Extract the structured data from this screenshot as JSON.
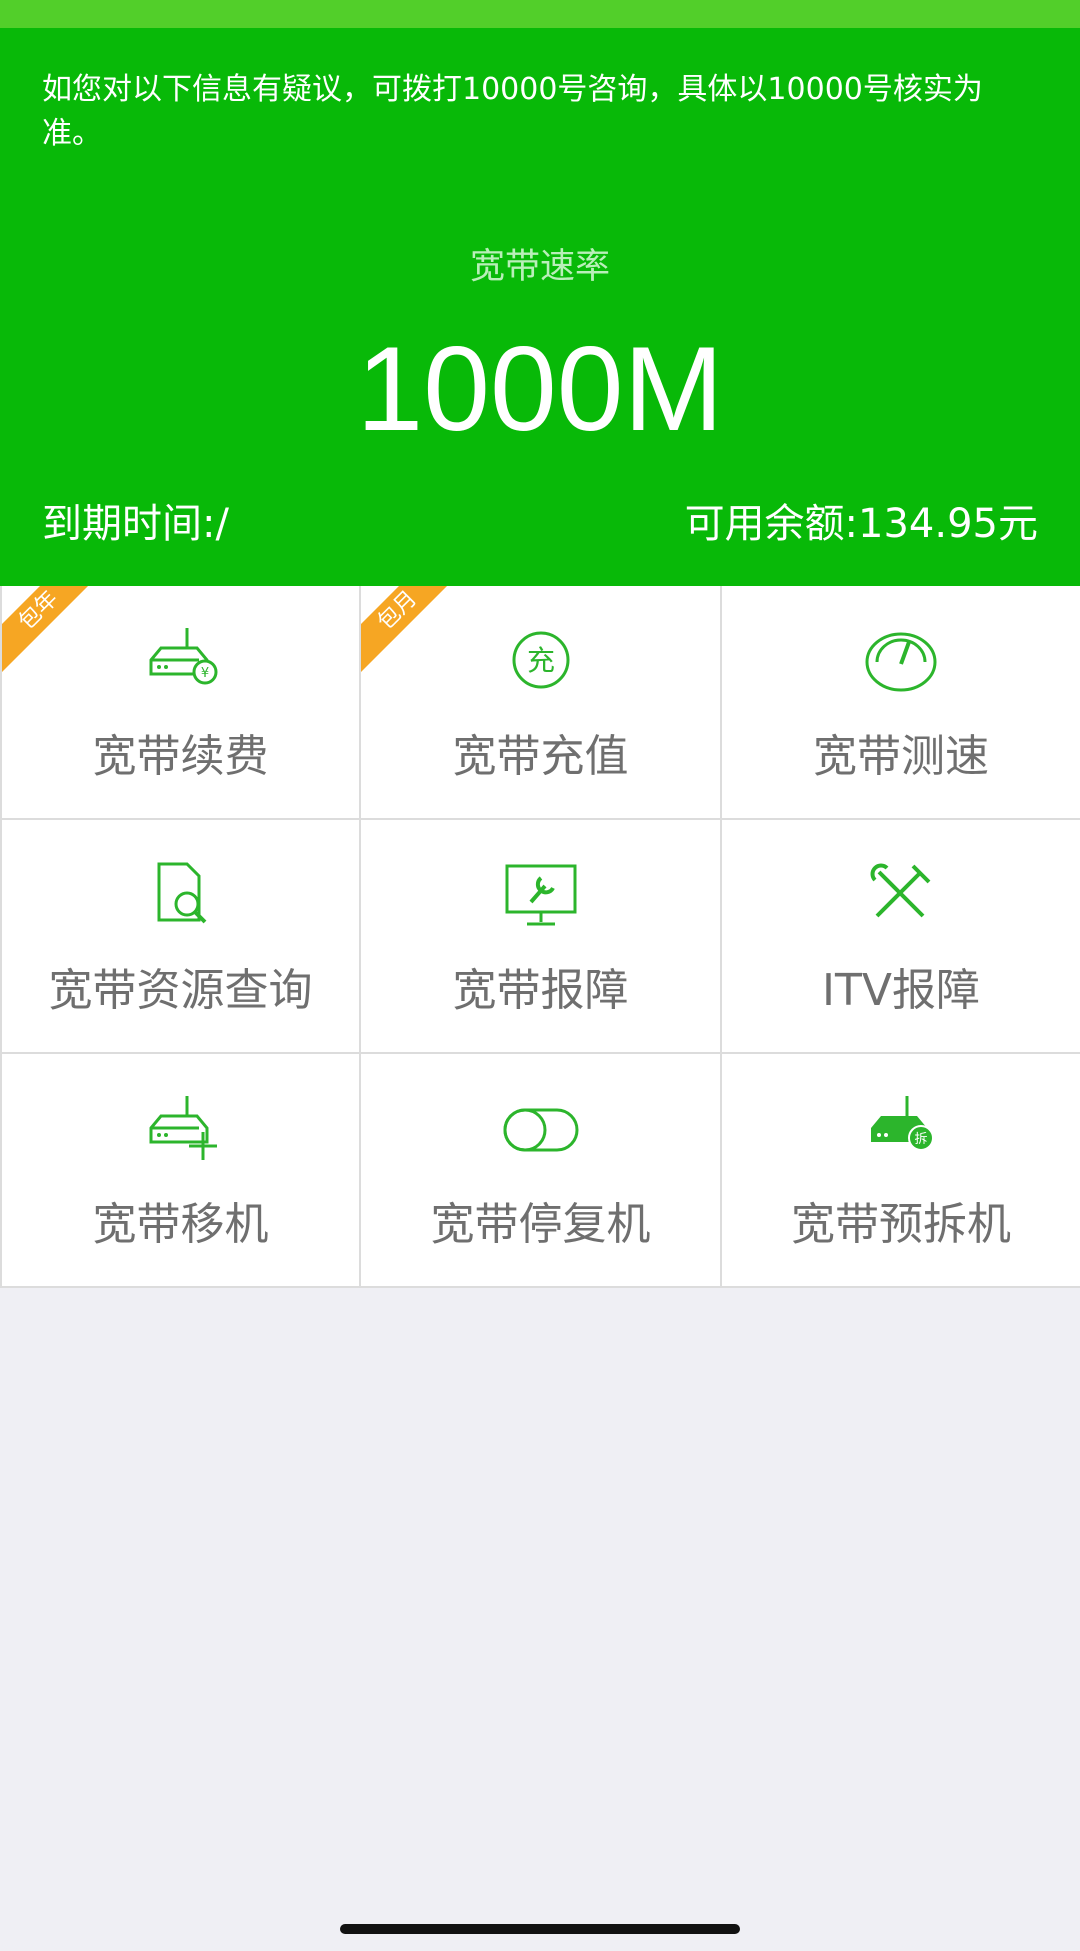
{
  "header": {
    "notice": "如您对以下信息有疑议，可拨打10000号咨询，具体以10000号核实为准。",
    "rate_label": "宽带速率",
    "rate_value": "1000M",
    "expire_text": "到期时间:/",
    "balance_text": "可用余额:134.95元"
  },
  "colors": {
    "primary_green": "#08b908",
    "status_green": "#52cf2a",
    "ribbon_orange": "#f6a623",
    "icon_green": "#2cb52c"
  },
  "grid": {
    "items": [
      {
        "label": "宽带续费",
        "icon": "router-yen-icon",
        "badge": "包年"
      },
      {
        "label": "宽带充值",
        "icon": "recharge-circle-icon",
        "badge": "包月"
      },
      {
        "label": "宽带测速",
        "icon": "speedometer-icon"
      },
      {
        "label": "宽带资源查询",
        "icon": "document-search-icon"
      },
      {
        "label": "宽带报障",
        "icon": "monitor-wrench-icon"
      },
      {
        "label": "ITV报障",
        "icon": "tools-icon"
      },
      {
        "label": "宽带移机",
        "icon": "router-move-icon"
      },
      {
        "label": "宽带停复机",
        "icon": "toggle-icon"
      },
      {
        "label": "宽带预拆机",
        "icon": "router-dismantle-icon",
        "icon_text": "拆"
      }
    ]
  }
}
